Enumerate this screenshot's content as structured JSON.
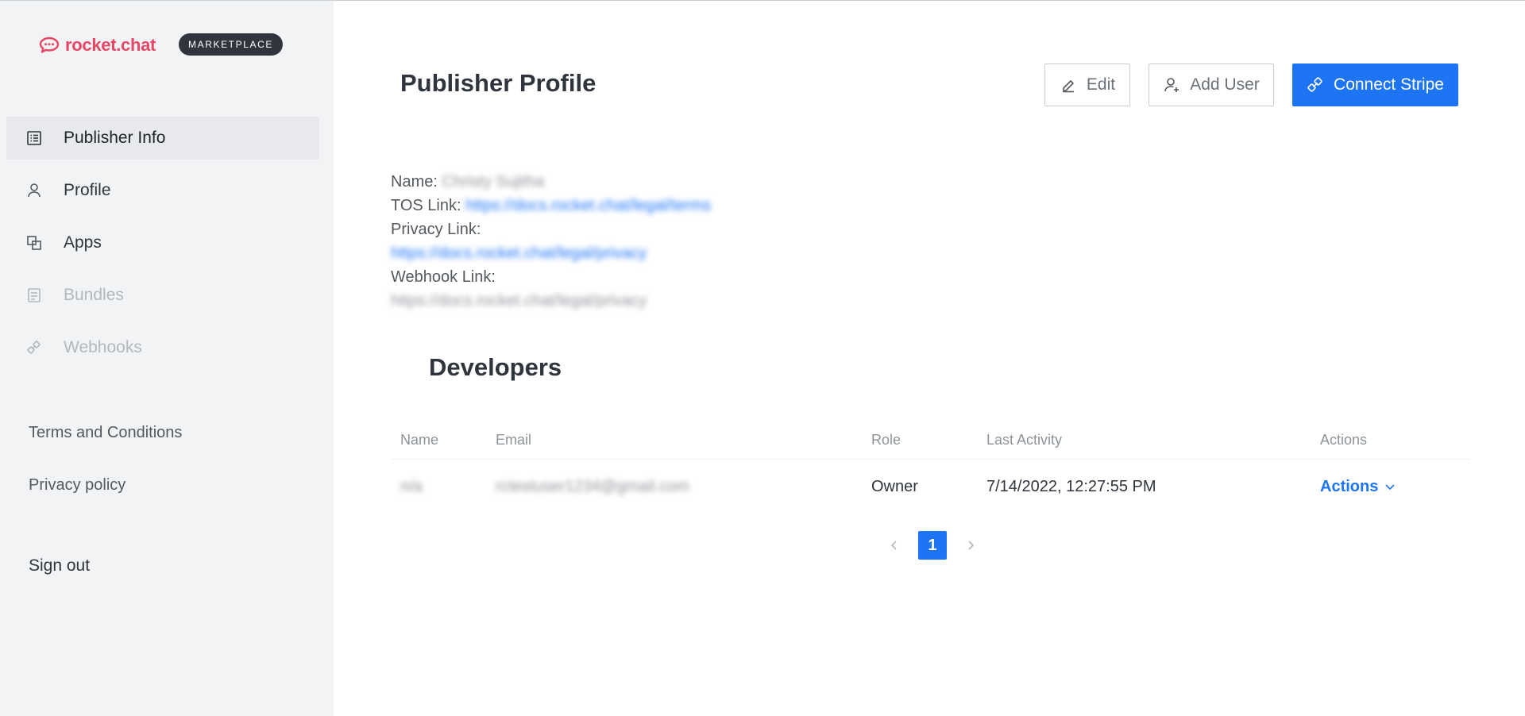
{
  "brand": {
    "name": "rocket.chat",
    "badge": "MARKETPLACE",
    "color": "#e64765"
  },
  "sidebar": {
    "items": [
      {
        "label": "Publisher Info",
        "icon": "list-icon",
        "active": true
      },
      {
        "label": "Profile",
        "icon": "user-icon"
      },
      {
        "label": "Apps",
        "icon": "apps-icon"
      },
      {
        "label": "Bundles",
        "icon": "bundle-icon",
        "disabled": true
      },
      {
        "label": "Webhooks",
        "icon": "webhook-icon",
        "disabled": true
      }
    ],
    "footer": [
      "Terms and Conditions",
      "Privacy policy"
    ],
    "signout": "Sign out"
  },
  "header": {
    "title": "Publisher Profile",
    "edit_label": "Edit",
    "add_user_label": "Add User",
    "connect_stripe_label": "Connect Stripe"
  },
  "publisher": {
    "name_label": "Name:",
    "name_value": "Christy Sujitha",
    "tos_label": "TOS Link:",
    "tos_value": "https://docs.rocket.chat/legal/terms",
    "privacy_label": "Privacy Link:",
    "privacy_value": "https://docs.rocket.chat/legal/privacy",
    "webhook_label": "Webhook Link:",
    "webhook_value": "https://docs.rocket.chat/legal/privacy"
  },
  "developers": {
    "title": "Developers",
    "columns": [
      "Name",
      "Email",
      "Role",
      "Last Activity",
      "Actions"
    ],
    "rows": [
      {
        "name": "n/a",
        "email": "rctestuser1234@gmail.com",
        "role": "Owner",
        "last_activity": "7/14/2022, 12:27:55 PM",
        "actions": "Actions"
      }
    ]
  },
  "pagination": {
    "current_page": "1"
  },
  "colors": {
    "accent": "#1d74f5",
    "sidebar_bg": "#f2f3f5",
    "text": "#2f343d"
  }
}
